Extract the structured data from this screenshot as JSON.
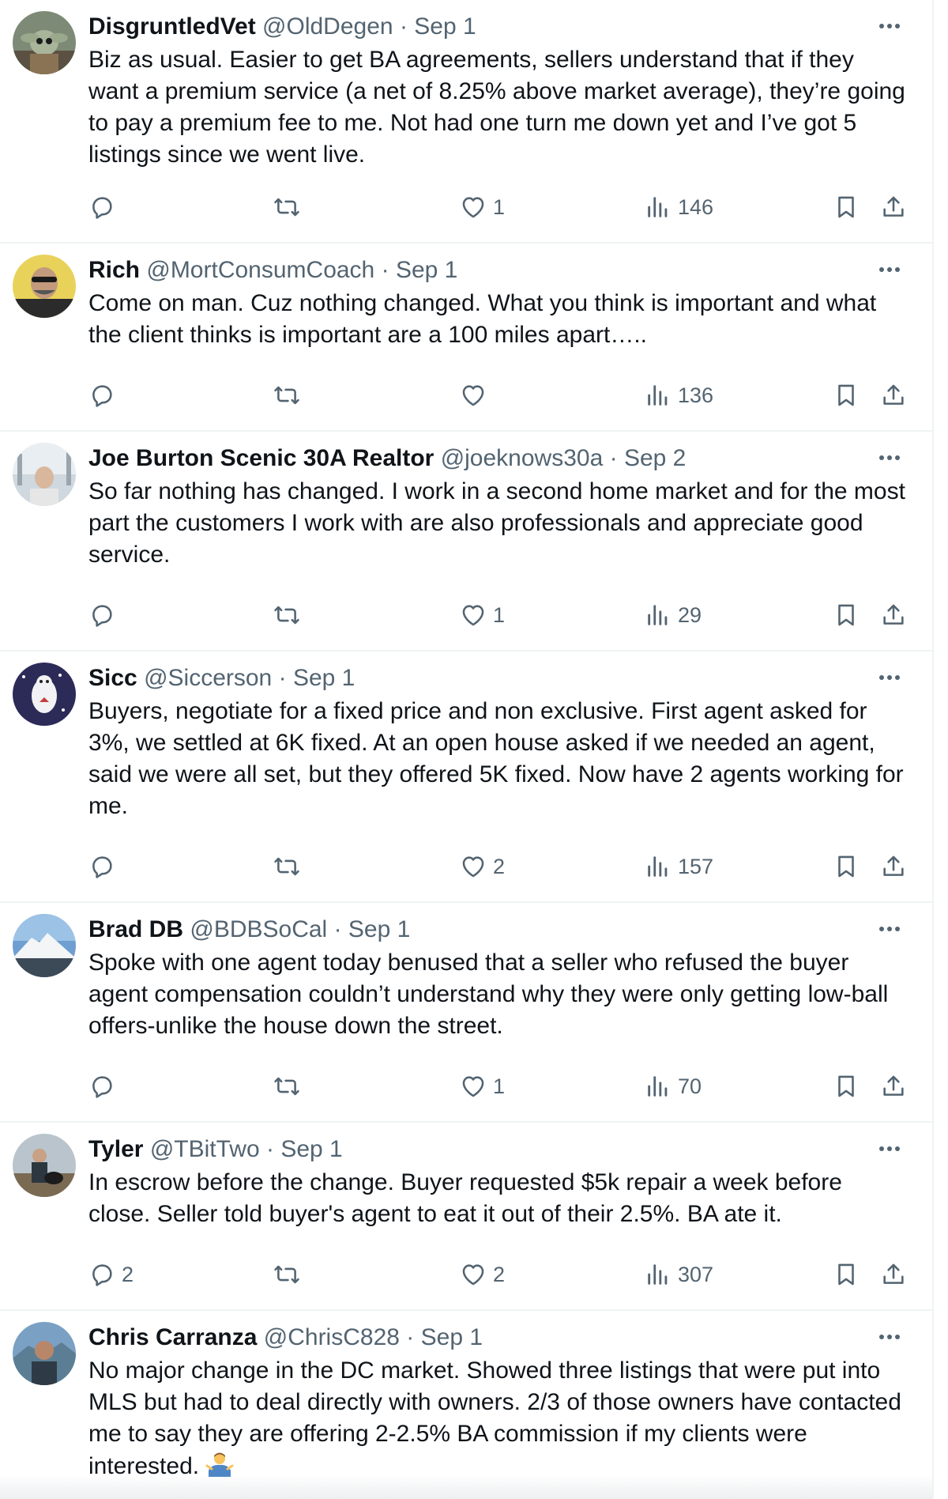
{
  "tweets": [
    {
      "name": "DisgruntledVet",
      "handle": "@OldDegen",
      "separator": "·",
      "date": "Sep 1",
      "text": "Biz as usual. Easier to get BA agreements, sellers understand that if they want a premium service (a net of 8.25% above market average), they’re going to pay a premium fee to me.  Not had one turn me down yet and I’ve got 5 listings since we went live.",
      "replies": "",
      "reposts": "",
      "likes": "1",
      "views": "146"
    },
    {
      "name": "Rich",
      "handle": "@MortConsumCoach",
      "separator": "·",
      "date": "Sep 1",
      "text": "Come on man.  Cuz nothing changed.   What you think is important and what the client thinks is important are a 100 miles apart…..",
      "replies": "",
      "reposts": "",
      "likes": "",
      "views": "136"
    },
    {
      "name": "Joe Burton Scenic 30A Realtor",
      "handle": "@joeknows30a",
      "separator": "·",
      "date": "Sep 2",
      "text": "So far nothing has changed. I work in a second home market and for the most part the customers I work with are also professionals and appreciate good service.",
      "replies": "",
      "reposts": "",
      "likes": "1",
      "views": "29"
    },
    {
      "name": "Sicc",
      "handle": "@Siccerson",
      "separator": "·",
      "date": "Sep 1",
      "text": "Buyers, negotiate for a fixed price and non exclusive. First agent asked for 3%, we settled at 6K fixed. At an open house asked if we needed an agent, said we were all set, but they offered 5K fixed. Now have 2 agents working for me.",
      "replies": "",
      "reposts": "",
      "likes": "2",
      "views": "157"
    },
    {
      "name": "Brad DB",
      "handle": "@BDBSoCal",
      "separator": "·",
      "date": "Sep 1",
      "text": "Spoke with one agent today benused that a seller who refused the buyer agent compensation couldn’t understand why they were only getting low-ball offers-unlike the house down the street.",
      "replies": "",
      "reposts": "",
      "likes": "1",
      "views": "70"
    },
    {
      "name": "Tyler",
      "handle": "@TBitTwo",
      "separator": "·",
      "date": "Sep 1",
      "text": "In escrow before the change. Buyer requested $5k repair a week before close. Seller told buyer's agent to eat it out of their 2.5%. BA ate it.",
      "replies": "2",
      "reposts": "",
      "likes": "2",
      "views": "307"
    },
    {
      "name": "Chris Carranza",
      "handle": "@ChrisC828",
      "separator": "·",
      "date": "Sep 1",
      "text": "No major change in the DC market. Showed three listings that were put into MLS but had to deal directly with owners. 2/3 of those owners have contacted me to say they are offering 2-2.5% BA commission if my clients were interested.",
      "emoji": "person-shrugging-emoji"
    }
  ],
  "icons": {
    "reply": "reply-icon",
    "repost": "repost-icon",
    "like": "heart-icon",
    "views": "views-icon",
    "bookmark": "bookmark-icon",
    "share": "share-icon",
    "more": "more-icon"
  },
  "colors": {
    "text": "#0f1419",
    "secondary": "#536471",
    "divider": "#eff3f4"
  }
}
